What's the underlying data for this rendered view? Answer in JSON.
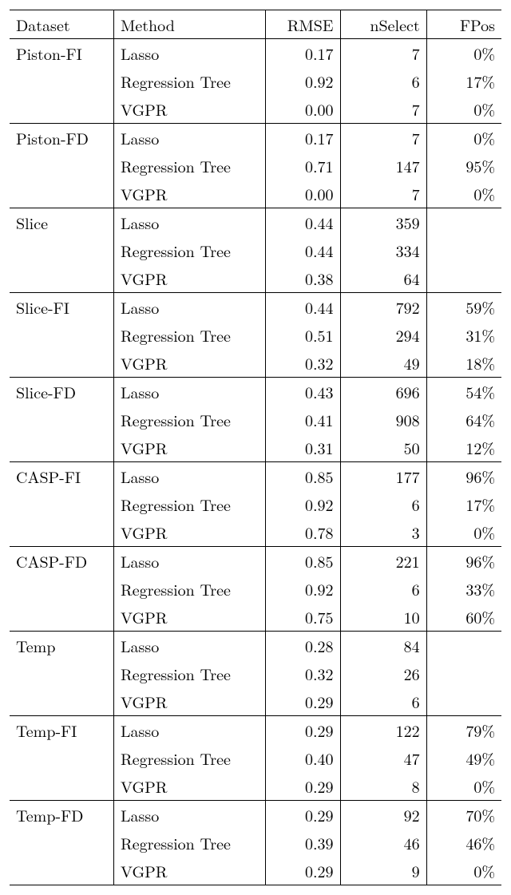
{
  "headers": {
    "dataset": "Dataset",
    "method": "Method",
    "rmse": "RMSE",
    "nselect": "nSelect",
    "fpos": "FPos"
  },
  "chart_data": {
    "type": "table",
    "columns": [
      "Dataset",
      "Method",
      "RMSE",
      "nSelect",
      "FPos"
    ],
    "groups": [
      {
        "dataset": "Piston-FI",
        "rows": [
          {
            "method": "Lasso",
            "rmse": "0.17",
            "nselect": "7",
            "fpos": "0%"
          },
          {
            "method": "Regression Tree",
            "rmse": "0.92",
            "nselect": "6",
            "fpos": "17%"
          },
          {
            "method": "VGPR",
            "rmse": "0.00",
            "nselect": "7",
            "fpos": "0%"
          }
        ]
      },
      {
        "dataset": "Piston-FD",
        "rows": [
          {
            "method": "Lasso",
            "rmse": "0.17",
            "nselect": "7",
            "fpos": "0%"
          },
          {
            "method": "Regression Tree",
            "rmse": "0.71",
            "nselect": "147",
            "fpos": "95%"
          },
          {
            "method": "VGPR",
            "rmse": "0.00",
            "nselect": "7",
            "fpos": "0%"
          }
        ]
      },
      {
        "dataset": "Slice",
        "rows": [
          {
            "method": "Lasso",
            "rmse": "0.44",
            "nselect": "359",
            "fpos": ""
          },
          {
            "method": "Regression Tree",
            "rmse": "0.44",
            "nselect": "334",
            "fpos": ""
          },
          {
            "method": "VGPR",
            "rmse": "0.38",
            "nselect": "64",
            "fpos": ""
          }
        ]
      },
      {
        "dataset": "Slice-FI",
        "rows": [
          {
            "method": "Lasso",
            "rmse": "0.44",
            "nselect": "792",
            "fpos": "59%"
          },
          {
            "method": "Regression Tree",
            "rmse": "0.51",
            "nselect": "294",
            "fpos": "31%"
          },
          {
            "method": "VGPR",
            "rmse": "0.32",
            "nselect": "49",
            "fpos": "18%"
          }
        ]
      },
      {
        "dataset": "Slice-FD",
        "rows": [
          {
            "method": "Lasso",
            "rmse": "0.43",
            "nselect": "696",
            "fpos": "54%"
          },
          {
            "method": "Regression Tree",
            "rmse": "0.41",
            "nselect": "908",
            "fpos": "64%"
          },
          {
            "method": "VGPR",
            "rmse": "0.31",
            "nselect": "50",
            "fpos": "12%"
          }
        ]
      },
      {
        "dataset": "CASP-FI",
        "rows": [
          {
            "method": "Lasso",
            "rmse": "0.85",
            "nselect": "177",
            "fpos": "96%"
          },
          {
            "method": "Regression Tree",
            "rmse": "0.92",
            "nselect": "6",
            "fpos": "17%"
          },
          {
            "method": "VGPR",
            "rmse": "0.78",
            "nselect": "3",
            "fpos": "0%"
          }
        ]
      },
      {
        "dataset": "CASP-FD",
        "rows": [
          {
            "method": "Lasso",
            "rmse": "0.85",
            "nselect": "221",
            "fpos": "96%"
          },
          {
            "method": "Regression Tree",
            "rmse": "0.92",
            "nselect": "6",
            "fpos": "33%"
          },
          {
            "method": "VGPR",
            "rmse": "0.75",
            "nselect": "10",
            "fpos": "60%"
          }
        ]
      },
      {
        "dataset": "Temp",
        "rows": [
          {
            "method": "Lasso",
            "rmse": "0.28",
            "nselect": "84",
            "fpos": ""
          },
          {
            "method": "Regression Tree",
            "rmse": "0.32",
            "nselect": "26",
            "fpos": ""
          },
          {
            "method": "VGPR",
            "rmse": "0.29",
            "nselect": "6",
            "fpos": ""
          }
        ]
      },
      {
        "dataset": "Temp-FI",
        "rows": [
          {
            "method": "Lasso",
            "rmse": "0.29",
            "nselect": "122",
            "fpos": "79%"
          },
          {
            "method": "Regression Tree",
            "rmse": "0.40",
            "nselect": "47",
            "fpos": "49%"
          },
          {
            "method": "VGPR",
            "rmse": "0.29",
            "nselect": "8",
            "fpos": "0%"
          }
        ]
      },
      {
        "dataset": "Temp-FD",
        "rows": [
          {
            "method": "Lasso",
            "rmse": "0.29",
            "nselect": "92",
            "fpos": "70%"
          },
          {
            "method": "Regression Tree",
            "rmse": "0.39",
            "nselect": "46",
            "fpos": "46%"
          },
          {
            "method": "VGPR",
            "rmse": "0.29",
            "nselect": "9",
            "fpos": "0%"
          }
        ]
      }
    ]
  }
}
